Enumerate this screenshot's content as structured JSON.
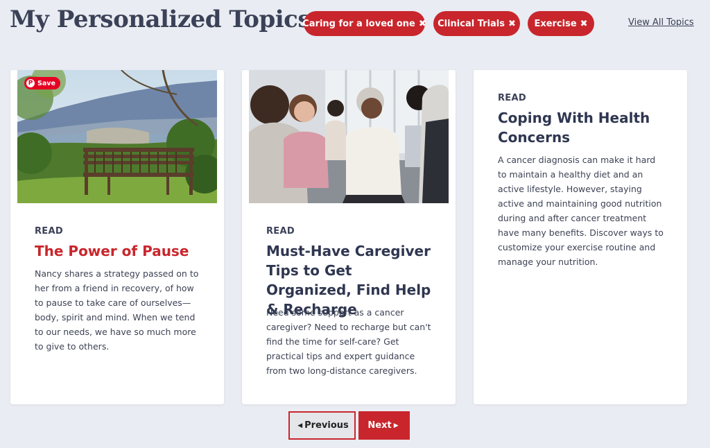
{
  "header": {
    "title": "My Personalized Topics",
    "chips": [
      {
        "label": "Caring for a loved one"
      },
      {
        "label": "Clinical Trials"
      },
      {
        "label": "Exercise"
      }
    ],
    "view_all": "View All Topics"
  },
  "cards": [
    {
      "kicker": "READ",
      "title": "The Power of Pause",
      "body": "Nancy shares a strategy passed on to her from a friend in recovery, of how to pause to take care of ourselves—body, spirit and mind. When we tend to our needs, we have so much more to give to others.",
      "save_label": "Save"
    },
    {
      "kicker": "READ",
      "title": "Must-Have Caregiver Tips to Get Organized, Find Help & Recharge",
      "body": "Need some support as a cancer caregiver? Need to recharge but can't find the time for self-care? Get practical tips and expert guidance from two long-distance caregivers."
    },
    {
      "kicker": "READ",
      "title": "Coping With Health Concerns",
      "body": "A cancer diagnosis can make it hard to maintain a healthy diet and an active lifestyle. However, staying active and maintaining good nutrition during and after cancer treatment have many benefits. Discover ways to customize your exercise routine and manage your nutrition."
    }
  ],
  "pagination": {
    "previous": "Previous",
    "next": "Next"
  },
  "colors": {
    "accent": "#c8262c",
    "background": "#e9ecf2",
    "heading": "#2f3650"
  },
  "icons": {
    "chip_remove": "close-x-icon",
    "prev": "caret-left-icon",
    "next": "caret-right-icon",
    "pinterest": "pinterest-icon"
  }
}
